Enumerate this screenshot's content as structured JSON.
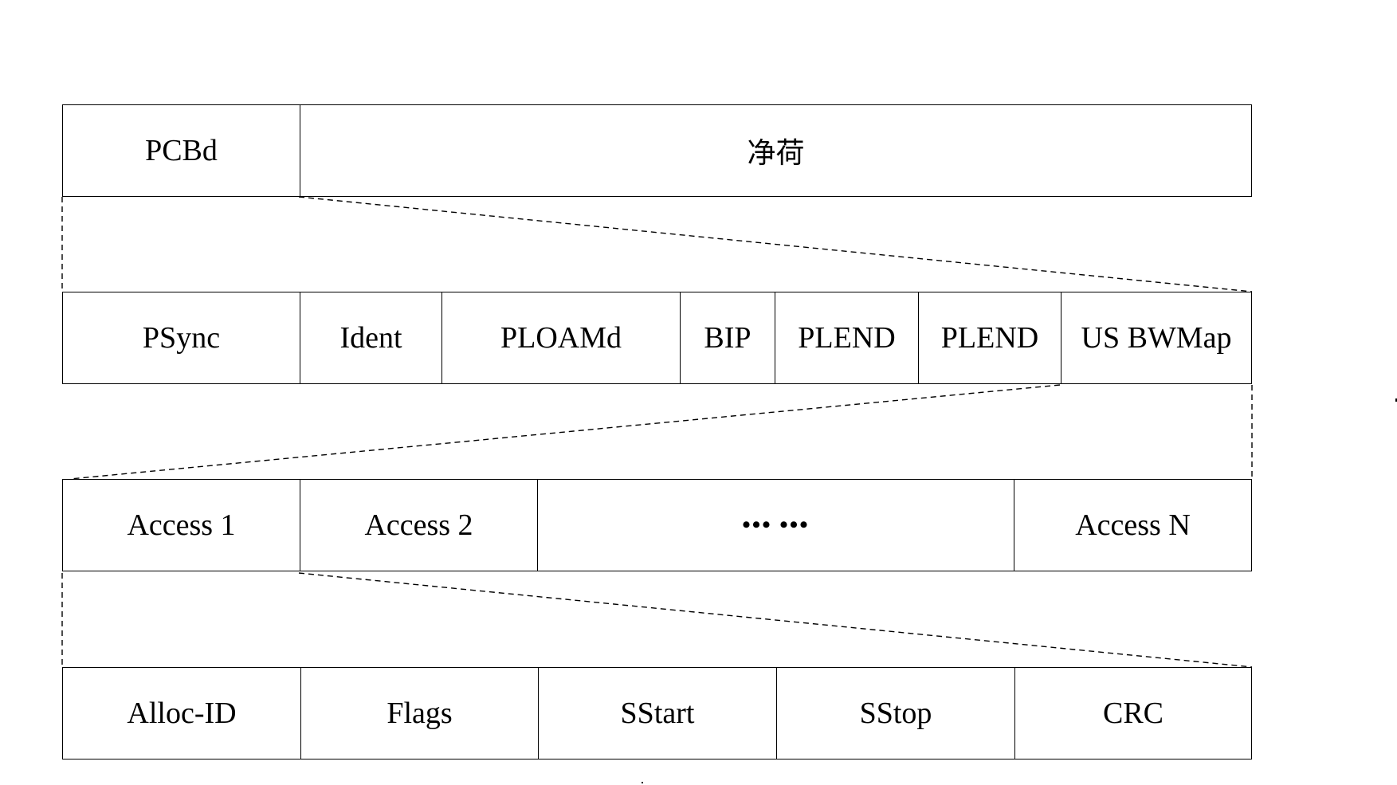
{
  "diagram": {
    "rows": [
      {
        "name": "frame",
        "cells": [
          "PCBd",
          "净荷"
        ]
      },
      {
        "name": "pcbd-expansion",
        "cells": [
          "PSync",
          "Ident",
          "PLOAMd",
          "BIP",
          "PLEND",
          "PLEND",
          "US BWMap"
        ]
      },
      {
        "name": "us-bwmap-expansion",
        "cells": [
          "Access 1",
          "Access 2",
          "••• •••",
          "Access N"
        ]
      },
      {
        "name": "access-expansion",
        "cells": [
          "Alloc-ID",
          "Flags",
          "SStart",
          "SStop",
          "CRC"
        ]
      }
    ],
    "expansions": [
      {
        "from_row": 0,
        "from_cell": "PCBd",
        "to_row": 1
      },
      {
        "from_row": 1,
        "from_cell": "US BWMap",
        "to_row": 2
      },
      {
        "from_row": 2,
        "from_cell": "Access 1",
        "to_row": 3
      }
    ]
  }
}
